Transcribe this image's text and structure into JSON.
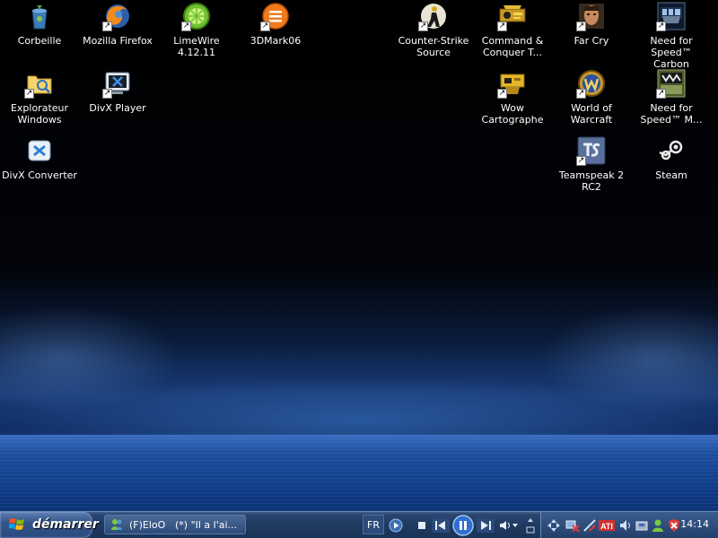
{
  "desktop": {
    "icons": [
      {
        "id": "corbeille",
        "label": "Corbeille",
        "icon": "recycle-bin-icon",
        "shortcut": false
      },
      {
        "id": "firefox",
        "label": "Mozilla Firefox",
        "icon": "firefox-icon",
        "shortcut": true
      },
      {
        "id": "limewire",
        "label": "LimeWire 4.12.11",
        "icon": "limewire-icon",
        "shortcut": true
      },
      {
        "id": "3dmark",
        "label": "3DMark06",
        "icon": "3dmark-icon",
        "shortcut": true
      },
      {
        "id": "explorateur",
        "label": "Explorateur Windows",
        "icon": "explorer-folder-icon",
        "shortcut": true
      },
      {
        "id": "divx-player",
        "label": "DivX Player",
        "icon": "divx-player-icon",
        "shortcut": true
      },
      {
        "id": "divx-converter",
        "label": "DivX Converter",
        "icon": "divx-converter-icon",
        "shortcut": false
      },
      {
        "id": "counter-strike",
        "label": "Counter-Strike Source",
        "icon": "counter-strike-icon",
        "shortcut": true
      },
      {
        "id": "command-conquer",
        "label": "Command & Conquer T...",
        "icon": "command-conquer-icon",
        "shortcut": true
      },
      {
        "id": "far-cry",
        "label": "Far Cry",
        "icon": "far-cry-icon",
        "shortcut": true
      },
      {
        "id": "nfs-carbon",
        "label": "Need for Speed™ Carbon",
        "icon": "nfs-carbon-icon",
        "shortcut": true
      },
      {
        "id": "wow-cartographe",
        "label": "Wow Cartographe",
        "icon": "wow-cartographe-icon",
        "shortcut": true
      },
      {
        "id": "world-of-warcraft",
        "label": "World of Warcraft",
        "icon": "world-of-warcraft-icon",
        "shortcut": true
      },
      {
        "id": "nfs-mw",
        "label": "Need for Speed™ M...",
        "icon": "nfs-most-wanted-icon",
        "shortcut": true
      },
      {
        "id": "teamspeak",
        "label": "Teamspeak 2 RC2",
        "icon": "teamspeak-icon",
        "shortcut": true
      },
      {
        "id": "steam",
        "label": "Steam",
        "icon": "steam-icon",
        "shortcut": false
      }
    ]
  },
  "taskbar": {
    "start_label": "démarrer",
    "tasks": [
      {
        "name": "(F)EloO",
        "title": "(*)  \"Il a l'ai..."
      }
    ],
    "language": "FR",
    "clock": "14:14",
    "media": [
      "play",
      "stop",
      "previous",
      "pause",
      "next",
      "volume"
    ]
  }
}
